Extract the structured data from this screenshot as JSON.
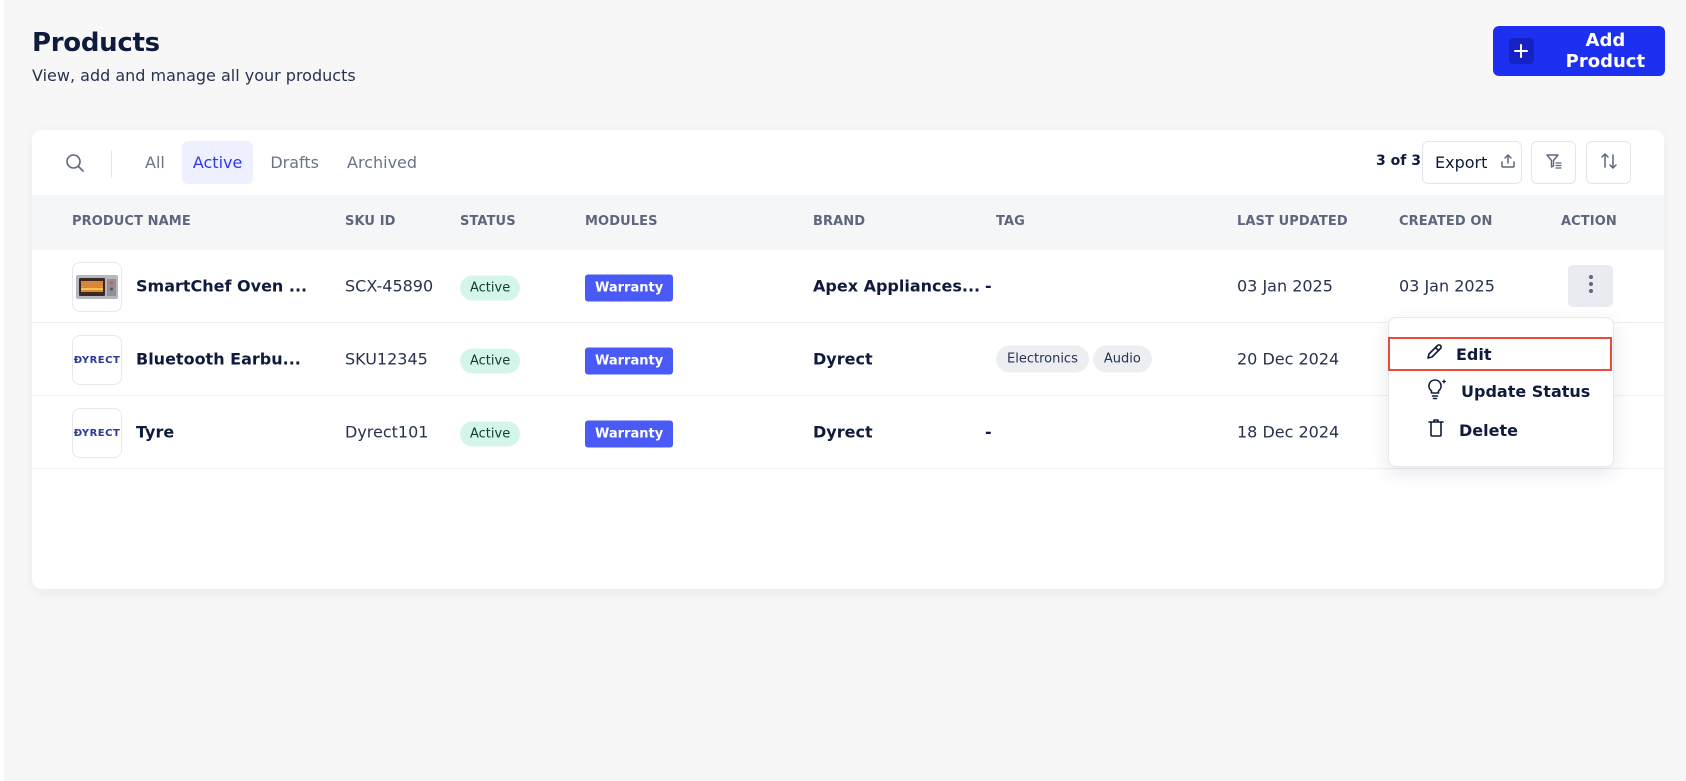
{
  "header": {
    "title": "Products",
    "subtitle": "View, add and manage all your products",
    "add_button_label": "Add Product"
  },
  "toolbar": {
    "tabs": [
      {
        "label": "All",
        "active": false
      },
      {
        "label": "Active",
        "active": true
      },
      {
        "label": "Drafts",
        "active": false
      },
      {
        "label": "Archived",
        "active": false
      }
    ],
    "count": "3 of 3",
    "export_label": "Export"
  },
  "table": {
    "columns": [
      "PRODUCT NAME",
      "SKU ID",
      "STATUS",
      "MODULES",
      "BRAND",
      "TAG",
      "LAST UPDATED",
      "CREATED ON",
      "ACTION"
    ],
    "rows": [
      {
        "name": "SmartChef Oven ...",
        "sku": "SCX-45890",
        "status": "Active",
        "module": "Warranty",
        "brand": "Apex Appliances...",
        "tags_text": "-",
        "last_updated": "03 Jan 2025",
        "created_on": "03 Jan 2025",
        "thumb": "oven"
      },
      {
        "name": "Bluetooth Earbu...",
        "sku": "SKU12345",
        "status": "Active",
        "module": "Warranty",
        "brand": "Dyrect",
        "tags": [
          "Electronics",
          "Audio"
        ],
        "last_updated": "20 Dec 2024",
        "thumb_text": "ÐYRECT"
      },
      {
        "name": "Tyre",
        "sku": "Dyrect101",
        "status": "Active",
        "module": "Warranty",
        "brand": "Dyrect",
        "tags_text": "-",
        "last_updated": "18 Dec 2024",
        "thumb_text": "ÐYRECT"
      }
    ]
  },
  "action_menu": {
    "items": [
      {
        "label": "Edit",
        "icon": "pencil-icon"
      },
      {
        "label": "Update Status",
        "icon": "lightbulb-sparkle-icon"
      },
      {
        "label": "Delete",
        "icon": "trash-icon"
      }
    ]
  },
  "colors": {
    "primary": "#1d2ff0",
    "active_tab_bg": "#eef0ff",
    "status_bg": "#d4f5ea",
    "module_bg": "#4a5af7",
    "highlight_border": "#e84a3b"
  }
}
